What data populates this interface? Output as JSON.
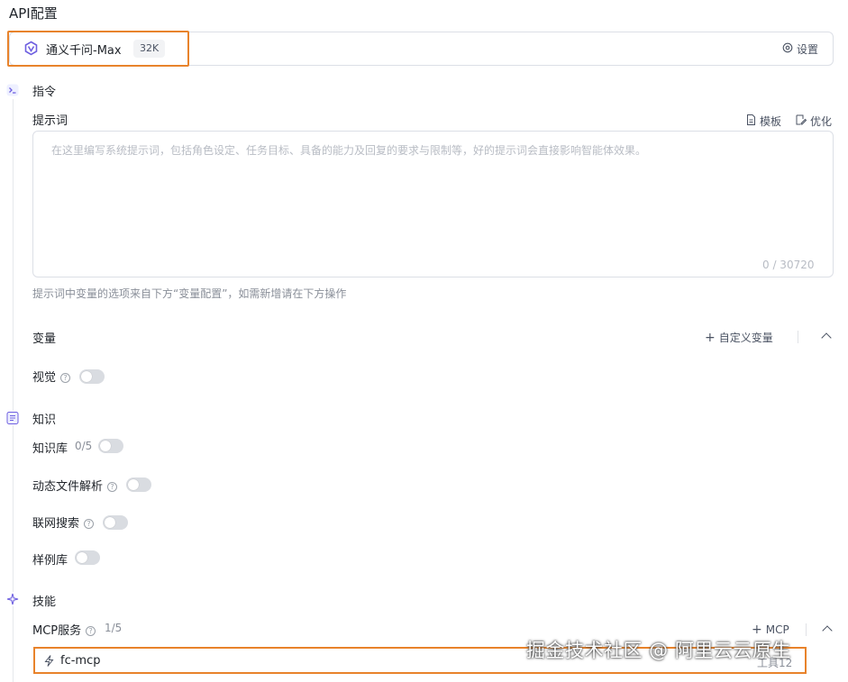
{
  "page": {
    "title": "API配置"
  },
  "model": {
    "name": "通义千问-Max",
    "context": "32K",
    "settings_label": "设置",
    "highlight_color": "#e8832b"
  },
  "instruction": {
    "section_title": "指令",
    "prompt_label": "提示词",
    "template_label": "模板",
    "optimize_label": "优化",
    "placeholder": "在这里编写系统提示词，包括角色设定、任务目标、具备的能力及回复的要求与限制等，好的提示词会直接影响智能体效果。",
    "counter": "0 / 30720",
    "hint": "提示词中变量的选项来自下方“变量配置”，如需新增请在下方操作"
  },
  "variables": {
    "label": "变量",
    "add_label": "自定义变量"
  },
  "vision": {
    "label": "视觉",
    "enabled": false
  },
  "knowledge": {
    "section_title": "知识",
    "kb_label": "知识库",
    "kb_count": "0/5",
    "dynamic_file_label": "动态文件解析",
    "web_search_label": "联网搜索",
    "samples_label": "样例库"
  },
  "skills": {
    "section_title": "技能",
    "mcp_label": "MCP服务",
    "mcp_count": "1/5",
    "add_mcp_label": "MCP",
    "mcp_items": [
      {
        "name": "fc-mcp",
        "tools": "工具12"
      }
    ]
  },
  "watermark": "掘金技术社区 @ 阿里云云原生",
  "colors": {
    "accent": "#e8832b",
    "icon_purple": "#6e5fe0",
    "toggle_off": "#d9dce1"
  }
}
